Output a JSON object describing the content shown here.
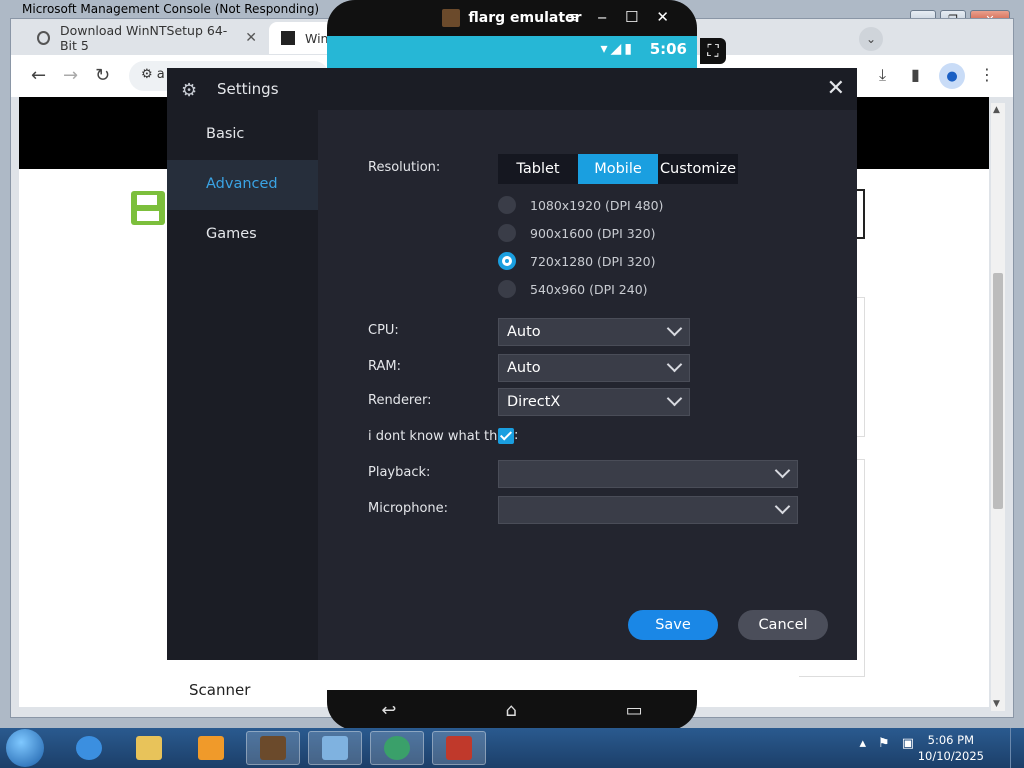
{
  "background_window": {
    "title": "Microsoft Management Console (Not Responding)"
  },
  "browser": {
    "tabs": [
      {
        "title": "Download WinNTSetup 64-Bit 5",
        "icon": "globe-icon"
      },
      {
        "title": "Wind",
        "icon": "bank-icon"
      }
    ],
    "address_text": "a",
    "page": {
      "scanner_text": "Scanner"
    }
  },
  "emulator": {
    "name": "flarg emulator",
    "status_time": "5:06"
  },
  "settings": {
    "title": "Settings",
    "sidebar": [
      {
        "label": "Basic",
        "active": false
      },
      {
        "label": "Advanced",
        "active": true
      },
      {
        "label": "Games",
        "active": false
      }
    ],
    "labels": {
      "resolution": "Resolution:",
      "cpu": "CPU:",
      "ram": "RAM:",
      "renderer": "Renderer:",
      "checkbox": "i dont know what this",
      "checkbox_tail": ":",
      "playback": "Playback:",
      "microphone": "Microphone:"
    },
    "resolution_modes": [
      "Tablet",
      "Mobile",
      "Customize"
    ],
    "resolution_selected_mode": "Mobile",
    "resolutions": [
      {
        "label": "1080x1920 (DPI 480)",
        "selected": false
      },
      {
        "label": "900x1600 (DPI 320)",
        "selected": false
      },
      {
        "label": "720x1280 (DPI 320)",
        "selected": true
      },
      {
        "label": "540x960 (DPI 240)",
        "selected": false
      }
    ],
    "values": {
      "cpu": "Auto",
      "ram": "Auto",
      "renderer": "DirectX",
      "playback": "",
      "microphone": ""
    },
    "checkbox_checked": true,
    "buttons": {
      "save": "Save",
      "cancel": "Cancel"
    }
  },
  "taskbar": {
    "time": "5:06 PM",
    "date": "10/10/2025"
  },
  "colors": {
    "accent": "#1a9fe0",
    "dialog_bg": "#23252f",
    "status_bar": "#26b7d6"
  }
}
